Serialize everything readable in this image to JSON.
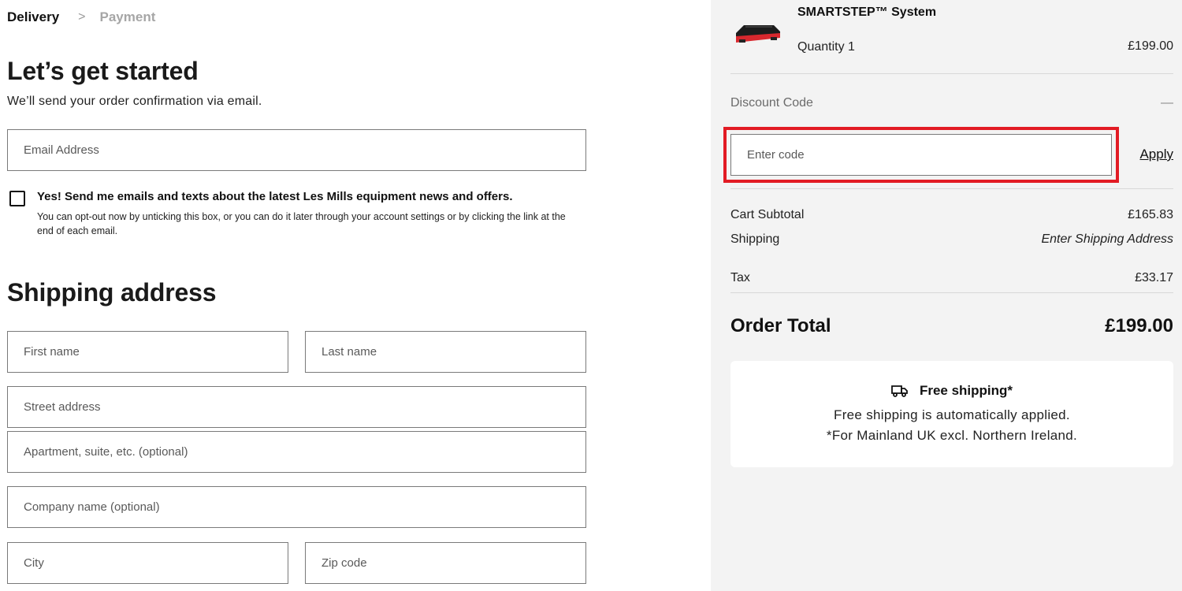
{
  "breadcrumb": {
    "step1": "Delivery",
    "separator": ">",
    "step2": "Payment"
  },
  "contact": {
    "title": "Let’s get started",
    "subtitle": "We’ll send your order confirmation via email.",
    "email_placeholder": "Email Address",
    "optin_title": "Yes! Send me emails and texts about the latest Les Mills equipment news and offers.",
    "optin_desc": "You can opt-out now by unticking this box, or you can do it later through your account settings or by clicking the link at the end of each email."
  },
  "shipping": {
    "title": "Shipping address",
    "first_name_placeholder": "First name",
    "last_name_placeholder": "Last name",
    "street_placeholder": "Street address",
    "apartment_placeholder": "Apartment, suite, etc. (optional)",
    "company_placeholder": "Company name (optional)",
    "city_placeholder": "City",
    "zip_placeholder": "Zip code"
  },
  "summary": {
    "product_name": "SMARTSTEP™ System",
    "quantity": "Quantity 1",
    "product_price": "£199.00",
    "discount_label": "Discount Code",
    "discount_toggle": "—",
    "code_placeholder": "Enter code",
    "apply_label": "Apply",
    "subtotal_label": "Cart Subtotal",
    "subtotal_value": "£165.83",
    "shipping_label": "Shipping",
    "shipping_value": "Enter Shipping Address",
    "tax_label": "Tax",
    "tax_value": "£33.17",
    "total_label": "Order Total",
    "total_value": "£199.00"
  },
  "free_shipping": {
    "title": "Free shipping*",
    "line1": "Free shipping is automatically applied.",
    "line2": "*For Mainland UK excl. Northern Ireland."
  },
  "colors": {
    "highlight": "#e21b24",
    "summary_bg": "#f3f3f3"
  },
  "icons": {
    "truck": "truck-icon",
    "product": "product-thumbnail"
  }
}
